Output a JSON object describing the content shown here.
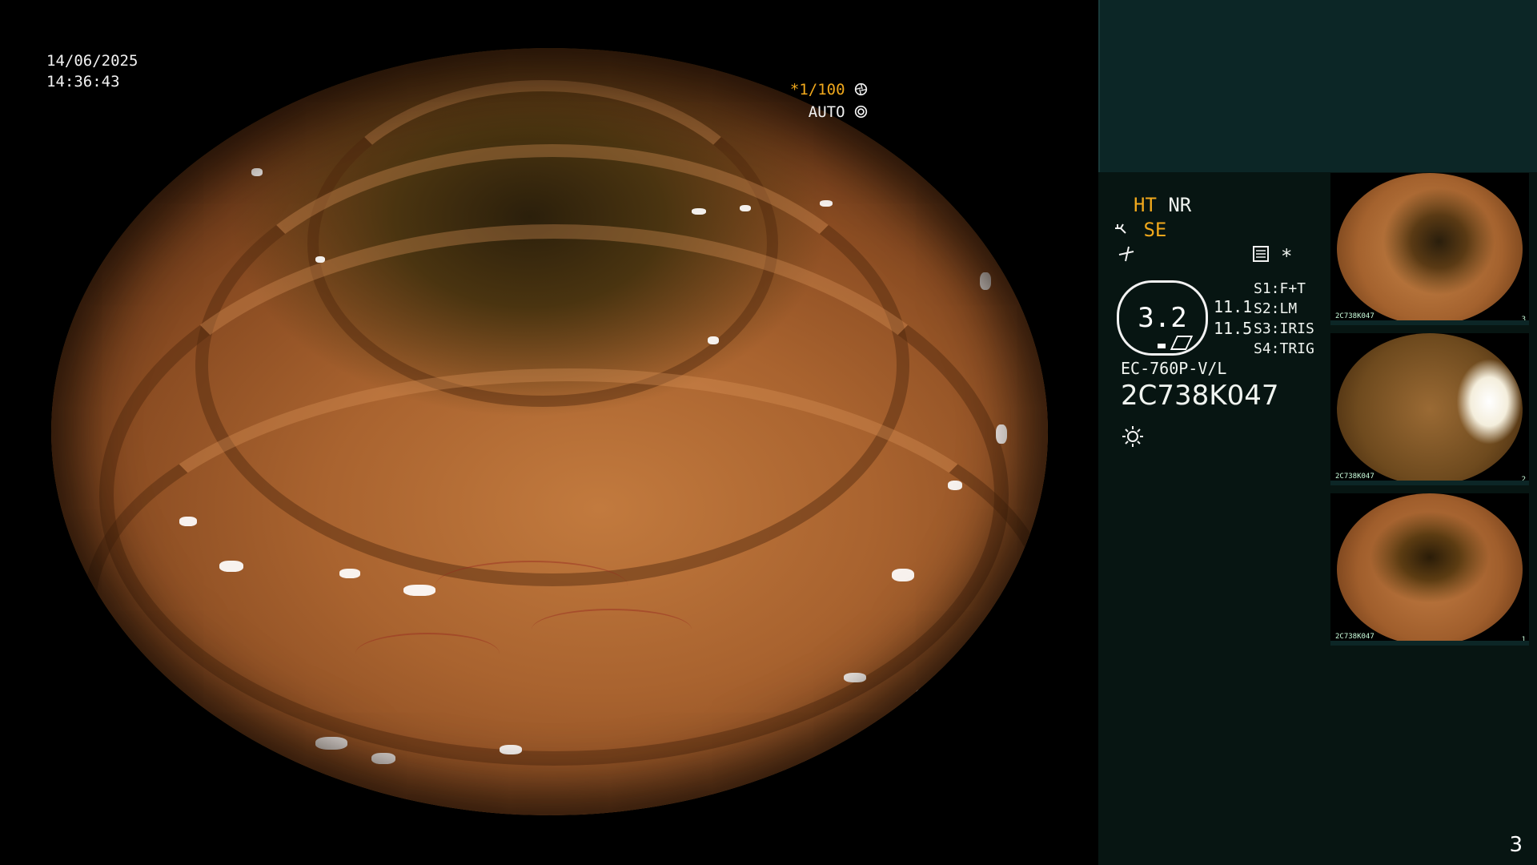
{
  "view": {
    "date": "14/06/2025",
    "time": "14:36:43",
    "shutter": "*1/100",
    "iris": "AUTO"
  },
  "panel": {
    "ht": "HT",
    "nr": "NR",
    "se": "SE",
    "lens_value": "3.2",
    "value_1": "11.1",
    "value_2": "11.5",
    "s1": "S1:F+T",
    "s2": "S2:LM",
    "s3": "S3:IRIS",
    "s4": "S4:TRIG",
    "scope_model": "EC-760P-V/L",
    "serial": "2C738K047",
    "asterisk": "*"
  },
  "thumbnails": [
    {
      "caption": "2C738K047",
      "index": "3"
    },
    {
      "caption": "2C738K047",
      "index": "2"
    },
    {
      "caption": "2C738K047",
      "index": "1"
    }
  ],
  "page_number": "3",
  "icons": {
    "shutter": "aperture-icon",
    "iris": "iris-icon",
    "light": "sun-icon",
    "settings": "list-icon",
    "structure": "wave-icon"
  }
}
